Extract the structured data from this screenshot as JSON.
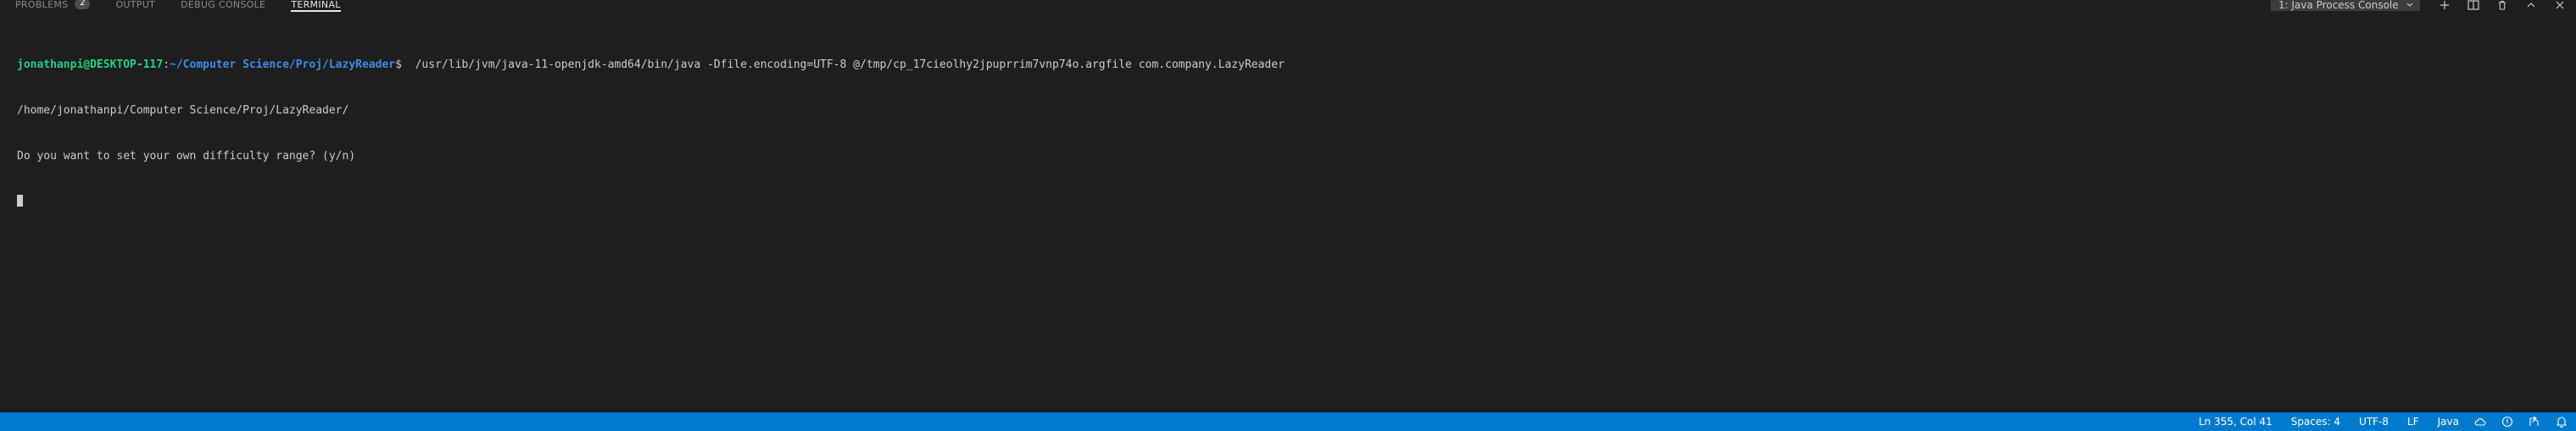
{
  "panel": {
    "tabs": [
      {
        "label": "PROBLEMS",
        "badge": "2"
      },
      {
        "label": "OUTPUT"
      },
      {
        "label": "DEBUG CONSOLE"
      },
      {
        "label": "TERMINAL",
        "active": true
      }
    ],
    "terminal_select": "1: Java Process Console",
    "actions": [
      "add-icon",
      "split-icon",
      "trash-icon",
      "chevron-up-icon",
      "close-icon"
    ]
  },
  "terminal": {
    "prompt_user": "jonathanpi@DESKTOP-117",
    "prompt_sep": ":",
    "prompt_path": "~/Computer Science/Proj/LazyReader",
    "prompt_symbol": "$",
    "command": "  /usr/lib/jvm/java-11-openjdk-amd64/bin/java -Dfile.encoding=UTF-8 @/tmp/cp_17cieolhy2jpuprrim7vnp74o.argfile com.company.LazyReader",
    "output_lines": [
      "/home/jonathanpi/Computer Science/Proj/LazyReader/",
      "Do you want to set your own difficulty range? (y/n)"
    ]
  },
  "statusbar": {
    "position": "Ln 355, Col 41",
    "spaces": "Spaces: 4",
    "encoding": "UTF-8",
    "eol": "LF",
    "language": "Java",
    "icons": [
      "cloud-icon",
      "feedback-icon",
      "live-share-icon",
      "bell-icon"
    ]
  },
  "colors": {
    "background": "#1e1e1e",
    "statusbar": "#007acc",
    "prompt_user": "#23d18b",
    "prompt_path": "#3b8eea"
  }
}
